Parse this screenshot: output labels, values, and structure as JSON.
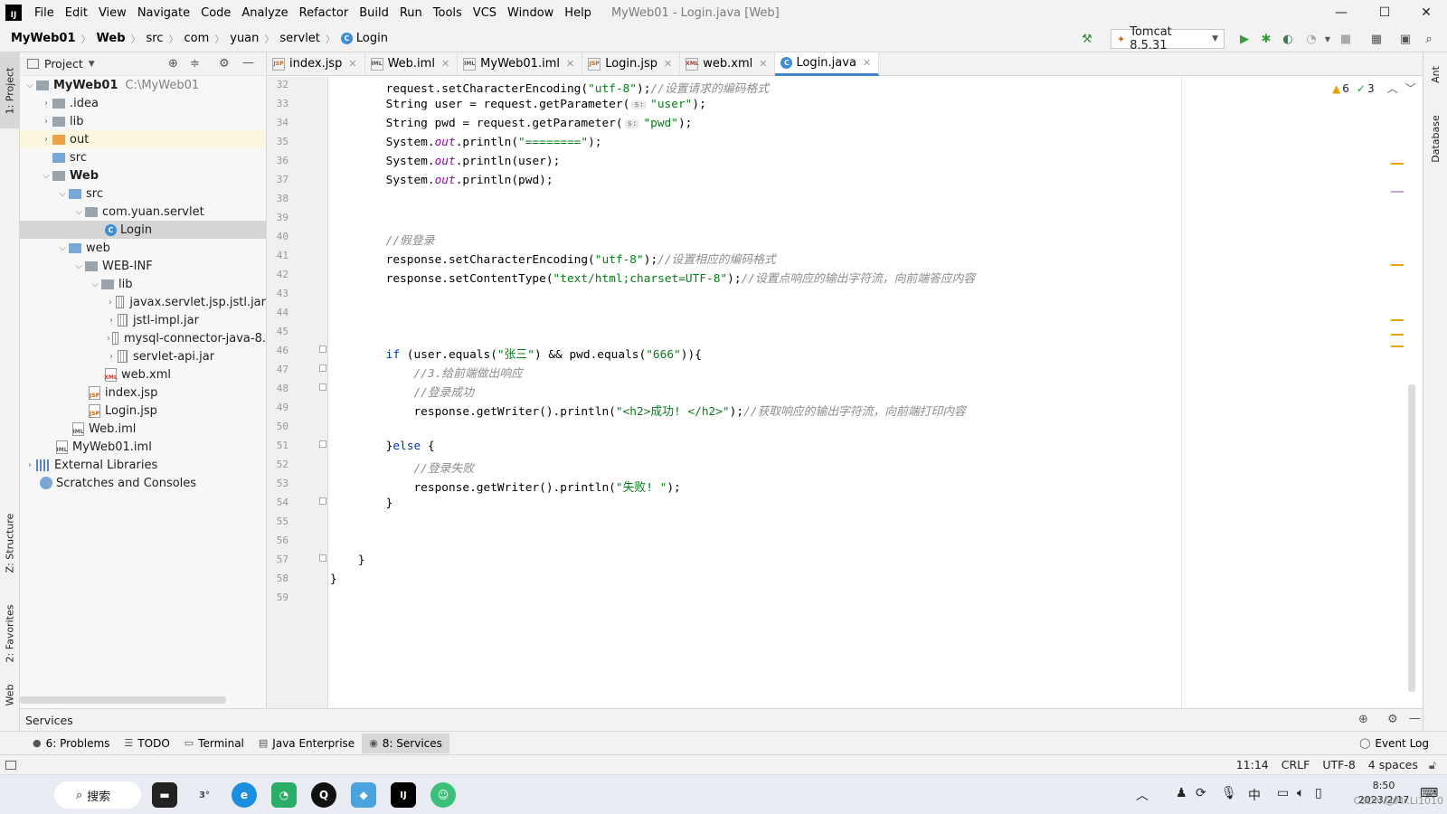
{
  "menubar": {
    "logo": "IJ",
    "items": [
      "File",
      "Edit",
      "View",
      "Navigate",
      "Code",
      "Analyze",
      "Refactor",
      "Build",
      "Run",
      "Tools",
      "VCS",
      "Window",
      "Help"
    ],
    "title": "MyWeb01 - Login.java [Web]",
    "minimize": "—",
    "maximize": "☐",
    "close": "✕"
  },
  "breadcrumb": [
    "MyWeb01",
    "Web",
    "src",
    "com",
    "yuan",
    "servlet",
    "Login"
  ],
  "toolbar": {
    "run_config": "Tomcat 8.5.31"
  },
  "left_stripe": {
    "project": "1: Project",
    "structure": "Z: Structure",
    "favorites": "2: Favorites",
    "web": "Web"
  },
  "right_stripe": {
    "ant": "Ant",
    "database": "Database"
  },
  "project_panel": {
    "title": "Project",
    "tree": [
      {
        "label": "MyWeb01",
        "hint": "C:\\MyWeb01"
      },
      {
        "label": ".idea"
      },
      {
        "label": "lib"
      },
      {
        "label": "out"
      },
      {
        "label": "src"
      },
      {
        "label": "Web"
      },
      {
        "label": "src"
      },
      {
        "label": "com.yuan.servlet"
      },
      {
        "label": "Login"
      },
      {
        "label": "web"
      },
      {
        "label": "WEB-INF"
      },
      {
        "label": "lib"
      },
      {
        "label": "javax.servlet.jsp.jstl.jar"
      },
      {
        "label": "jstl-impl.jar"
      },
      {
        "label": "mysql-connector-java-8."
      },
      {
        "label": "servlet-api.jar"
      },
      {
        "label": "web.xml"
      },
      {
        "label": "index.jsp"
      },
      {
        "label": "Login.jsp"
      },
      {
        "label": "Web.iml"
      },
      {
        "label": "MyWeb01.iml"
      },
      {
        "label": "External Libraries"
      },
      {
        "label": "Scratches and Consoles"
      }
    ]
  },
  "editor_tabs": [
    "index.jsp",
    "Web.iml",
    "MyWeb01.iml",
    "Login.jsp",
    "web.xml",
    "Login.java"
  ],
  "inspections": {
    "warnings": "6",
    "weak": "3"
  },
  "editor": {
    "line_numbers": [
      "32",
      "33",
      "34",
      "35",
      "36",
      "37",
      "38",
      "39",
      "40",
      "41",
      "42",
      "43",
      "44",
      "45",
      "46",
      "47",
      "48",
      "49",
      "50",
      "51",
      "52",
      "53",
      "54",
      "55",
      "56",
      "57",
      "58",
      "59"
    ],
    "lines": {
      "l32_a": "        request.setCharacterEncoding(",
      "l32_b": "\"utf-8\"",
      "l32_c": ");",
      "l32_d": "//设置请求的编码格式",
      "l33_a": "        String user = request.getParameter(",
      "l33_hint": "s:",
      "l33_b": "\"user\"",
      "l33_c": ");",
      "l34_a": "        String pwd = request.getParameter(",
      "l34_hint": "s:",
      "l34_b": "\"pwd\"",
      "l34_c": ");",
      "l35_a": "        System.",
      "l35_f": "out",
      "l35_b": ".println(",
      "l35_s": "\"========\"",
      "l35_c": ");",
      "l36_a": "        System.",
      "l36_f": "out",
      "l36_b": ".println(user);",
      "l37_a": "        System.",
      "l37_f": "out",
      "l37_b": ".println(pwd);",
      "l40_cm": "        //假登录",
      "l41_a": "        response.setCharacterEncoding(",
      "l41_s": "\"utf-8\"",
      "l41_c": ");",
      "l41_cm": "//设置相应的编码格式",
      "l42_a": "        response.setContentType(",
      "l42_s": "\"text/html;charset=UTF-8\"",
      "l42_c": ");",
      "l42_cm": "//设置点响应的输出字符流，向前端答应内容",
      "l46_kw": "        if",
      "l46_a": " (user.equals(",
      "l46_s1": "\"张三\"",
      "l46_b": ") && pwd.equals(",
      "l46_s2": "\"666\"",
      "l46_c": ")){",
      "l47_cm": "            //3.给前端做出响应",
      "l48_cm": "            //登录成功",
      "l49_a": "            response.getWriter().println(",
      "l49_s": "\"<h2>成功! </h2>\"",
      "l49_c": ");",
      "l49_cm": "//获取响应的输出字符流，向前端打印内容",
      "l51_a": "        }",
      "l51_kw": "else",
      "l51_b": " {",
      "l52_cm": "            //登录失败",
      "l53_a": "            response.getWriter().println(",
      "l53_s": "\"失败! \"",
      "l53_c": ");",
      "l54": "        }",
      "l57": "    }",
      "l58": "}"
    }
  },
  "services": {
    "title": "Services"
  },
  "tool_windows": [
    {
      "label": "6: Problems"
    },
    {
      "label": "TODO"
    },
    {
      "label": "Terminal"
    },
    {
      "label": "Java Enterprise"
    },
    {
      "label": "8: Services"
    }
  ],
  "event_log": "Event Log",
  "status": {
    "position": "11:14",
    "line_sep": "CRLF",
    "encoding": "UTF-8",
    "indent": "4 spaces"
  },
  "taskbar": {
    "search": "搜索",
    "weather": "3°",
    "ime": "中",
    "time": "8:50",
    "date": "2023/2/17",
    "watermark": "CSDN @Mr.Li1010"
  },
  "colors": {
    "accent": "#4083c9",
    "string": "#067d17",
    "keyword": "#0033b3",
    "comment": "#8c8c8c",
    "field": "#871094",
    "warning": "#e2a500"
  }
}
